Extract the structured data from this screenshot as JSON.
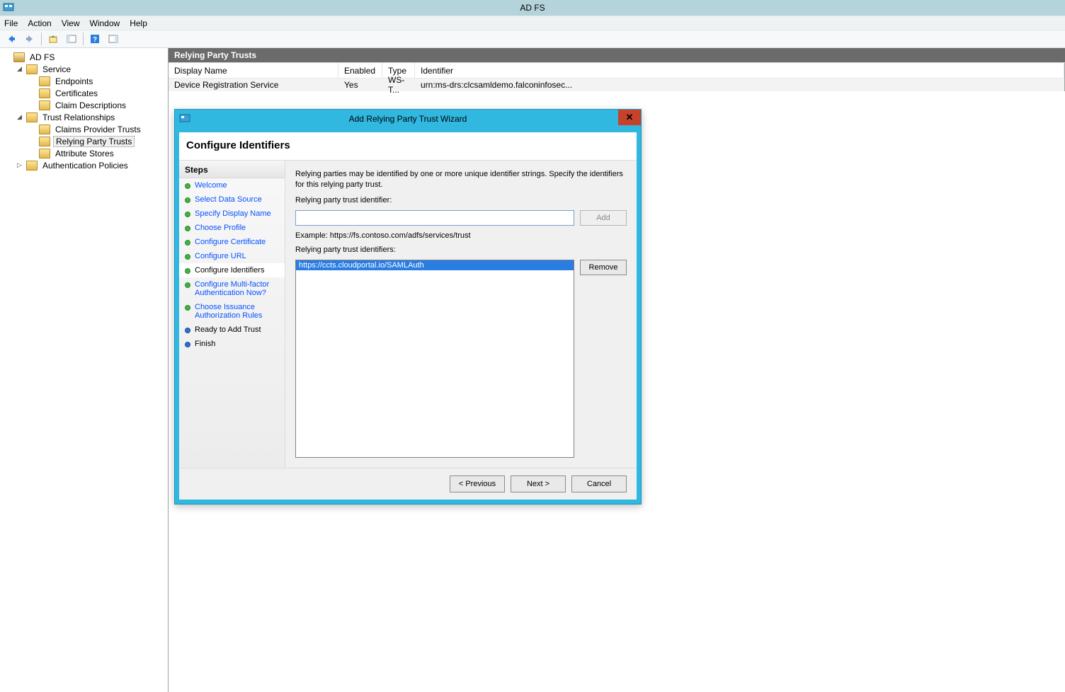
{
  "app_title": "AD FS",
  "menu": {
    "file": "File",
    "action": "Action",
    "view": "View",
    "window": "Window",
    "help": "Help"
  },
  "tree": {
    "root": "AD FS",
    "service": "Service",
    "endpoints": "Endpoints",
    "certificates": "Certificates",
    "claimdesc": "Claim Descriptions",
    "trustrel": "Trust Relationships",
    "claimsprov": "Claims Provider Trusts",
    "relying": "Relying Party Trusts",
    "attribstores": "Attribute Stores",
    "authpol": "Authentication Policies"
  },
  "content": {
    "header": "Relying Party Trusts",
    "cols": {
      "display": "Display Name",
      "enabled": "Enabled",
      "type": "Type",
      "identifier": "Identifier"
    },
    "row1": {
      "display": "Device Registration Service",
      "enabled": "Yes",
      "type": "WS-T...",
      "identifier": "urn:ms-drs:clcsamldemo.falconinfosec..."
    }
  },
  "wizard": {
    "title": "Add Relying Party Trust Wizard",
    "heading": "Configure Identifiers",
    "steps_label": "Steps",
    "steps": {
      "welcome": "Welcome",
      "select": "Select Data Source",
      "display": "Specify Display Name",
      "profile": "Choose Profile",
      "cert": "Configure Certificate",
      "url": "Configure URL",
      "ident": "Configure Identifiers",
      "mfa": "Configure Multi-factor Authentication Now?",
      "issuance": "Choose Issuance Authorization Rules",
      "ready": "Ready to Add Trust",
      "finish": "Finish"
    },
    "desc": "Relying parties may be identified by one or more unique identifier strings. Specify the identifiers for this relying party trust.",
    "label_identifier": "Relying party trust identifier:",
    "add": "Add",
    "example": "Example: https://fs.contoso.com/adfs/services/trust",
    "label_list": "Relying party trust identifiers:",
    "list_item": "https://ccts.cloudportal.io/SAMLAuth",
    "remove": "Remove",
    "prev": "< Previous",
    "next": "Next >",
    "cancel": "Cancel"
  }
}
